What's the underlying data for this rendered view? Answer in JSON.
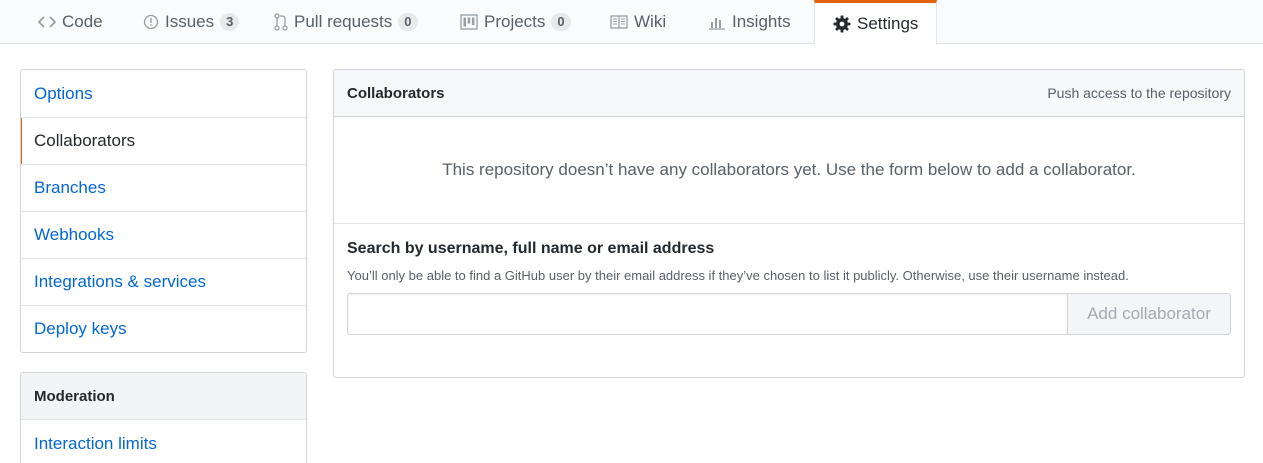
{
  "tabs": [
    {
      "label": "Code",
      "icon": "code-icon"
    },
    {
      "label": "Issues",
      "icon": "issue-opened-icon",
      "count": "3"
    },
    {
      "label": "Pull requests",
      "icon": "git-pull-request-icon",
      "count": "0"
    },
    {
      "label": "Projects",
      "icon": "project-icon",
      "count": "0"
    },
    {
      "label": "Wiki",
      "icon": "book-icon"
    },
    {
      "label": "Insights",
      "icon": "graph-icon"
    },
    {
      "label": "Settings",
      "icon": "gear-icon",
      "selected": true
    }
  ],
  "sidebar": {
    "items": [
      {
        "label": "Options"
      },
      {
        "label": "Collaborators",
        "selected": true
      },
      {
        "label": "Branches"
      },
      {
        "label": "Webhooks"
      },
      {
        "label": "Integrations & services"
      },
      {
        "label": "Deploy keys"
      }
    ],
    "moderation": {
      "heading": "Moderation",
      "items": [
        {
          "label": "Interaction limits"
        }
      ]
    }
  },
  "collaborators": {
    "title": "Collaborators",
    "note": "Push access to the repository",
    "blankslate": "This repository doesn’t have any collaborators yet. Use the form below to add a collaborator.",
    "search_heading": "Search by username, full name or email address",
    "search_note": "You’ll only be able to find a GitHub user by their email address if they’ve chosen to list it publicly. Otherwise, use their username instead.",
    "input_value": "",
    "add_button": "Add collaborator"
  },
  "colors": {
    "link": "#0366d6",
    "selected_accent": "#e36209",
    "muted": "#586069"
  }
}
